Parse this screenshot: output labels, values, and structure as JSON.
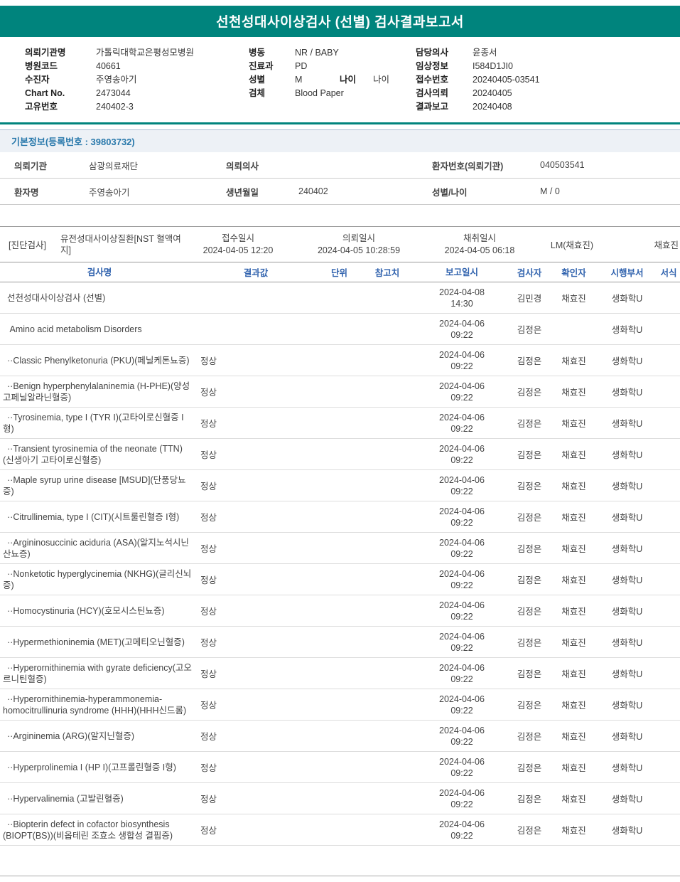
{
  "title": "선천성대사이상검사 (선별) 검사결과보고서",
  "accent_color": "#00847D",
  "header": {
    "left": [
      {
        "label": "의뢰기관명",
        "value": "가톨릭대학교은평성모병원"
      },
      {
        "label": "병원코드",
        "value": "40661"
      },
      {
        "label": "수진자",
        "value": "주영송아기"
      },
      {
        "label": "Chart No.",
        "value": "2473044"
      },
      {
        "label": "고유번호",
        "value": "240402-3"
      }
    ],
    "middle": [
      {
        "label": "병동",
        "value": "NR / BABY"
      },
      {
        "label": "진료과",
        "value": "PD"
      },
      {
        "label": "성별",
        "value": "M",
        "label2": "나이",
        "value2": "나이"
      },
      {
        "label": "검체",
        "value": "Blood Paper"
      }
    ],
    "right": [
      {
        "label": "담당의사",
        "value": "윤종서"
      },
      {
        "label": "임상정보",
        "value": "I584D1JI0"
      },
      {
        "label": "접수번호",
        "value": "20240405-03541"
      },
      {
        "label": "검사의뢰",
        "value": "20240405"
      },
      {
        "label": "결과보고",
        "value": "20240408"
      }
    ]
  },
  "basic_info": {
    "heading": "기본정보(등록번호 : 39803732)",
    "rows": [
      [
        {
          "label": "의뢰기관",
          "value": "삼광의료재단"
        },
        {
          "label": "의뢰의사",
          "value": ""
        },
        {
          "label": "환자번호(의뢰기관)",
          "value": "040503541"
        }
      ],
      [
        {
          "label": "환자명",
          "value": "주영송아기"
        },
        {
          "label": "생년월일",
          "value": "240402"
        },
        {
          "label": "성별/나이",
          "value": "M / 0"
        }
      ]
    ]
  },
  "exam_section": {
    "tag": "[진단검사]",
    "name": "유전성대사이상질환[NST 혈액여지]",
    "columns": [
      {
        "label": "접수일시",
        "value": "2024-04-05 12:20"
      },
      {
        "label": "의뢰일시",
        "value": "2024-04-05 10:28:59"
      },
      {
        "label": "채취일시",
        "value": "2024-04-05 06:18"
      }
    ],
    "collector": "LM(채효진)",
    "collector_right": "채효진"
  },
  "results_table": {
    "headers": [
      "검사명",
      "결과값",
      "단위",
      "참고치",
      "보고일시",
      "검사자",
      "확인자",
      "시행부서",
      "서식"
    ],
    "rows": [
      {
        "name": "선천성대사이상검사 (선별)",
        "result": "",
        "reported": "2024-04-08 14:30",
        "tester": "김민경",
        "verifier": "채효진",
        "dept": "생화학U"
      },
      {
        "name": " Amino acid metabolism Disorders",
        "result": "",
        "reported": "2024-04-06 09:22",
        "tester": "김정은",
        "verifier": "",
        "dept": "생화학U"
      },
      {
        "name": "··Classic Phenylketonuria (PKU)(페닐케톤뇨증)",
        "result": "정상",
        "reported": "2024-04-06 09:22",
        "tester": "김정은",
        "verifier": "채효진",
        "dept": "생화학U"
      },
      {
        "name": "··Benign hyperphenylalaninemia (H-PHE)(양성 고페닐알라닌혈증)",
        "result": "정상",
        "reported": "2024-04-06 09:22",
        "tester": "김정은",
        "verifier": "채효진",
        "dept": "생화학U"
      },
      {
        "name": "··Tyrosinemia, type I (TYR I)(고타이로신혈증 I형)",
        "result": "정상",
        "reported": "2024-04-06 09:22",
        "tester": "김정은",
        "verifier": "채효진",
        "dept": "생화학U"
      },
      {
        "name": "··Transient tyrosinemia of the neonate (TTN)(신생아기 고타이로신혈증)",
        "result": "정상",
        "reported": "2024-04-06 09:22",
        "tester": "김정은",
        "verifier": "채효진",
        "dept": "생화학U"
      },
      {
        "name": "··Maple syrup urine disease [MSUD](단풍당뇨증)",
        "result": "정상",
        "reported": "2024-04-06 09:22",
        "tester": "김정은",
        "verifier": "채효진",
        "dept": "생화학U"
      },
      {
        "name": "··Citrullinemia, type I (CIT)(시트룰린혈증 I형)",
        "result": "정상",
        "reported": "2024-04-06 09:22",
        "tester": "김정은",
        "verifier": "채효진",
        "dept": "생화학U"
      },
      {
        "name": "··Argininosuccinic aciduria (ASA)(알지노석시닌산뇨증)",
        "result": "정상",
        "reported": "2024-04-06 09:22",
        "tester": "김정은",
        "verifier": "채효진",
        "dept": "생화학U"
      },
      {
        "name": "··Nonketotic hyperglycinemia (NKHG)(글리신뇌증)",
        "result": "정상",
        "reported": "2024-04-06 09:22",
        "tester": "김정은",
        "verifier": "채효진",
        "dept": "생화학U"
      },
      {
        "name": "··Homocystinuria (HCY)(호모시스틴뇨증)",
        "result": "정상",
        "reported": "2024-04-06 09:22",
        "tester": "김정은",
        "verifier": "채효진",
        "dept": "생화학U"
      },
      {
        "name": "··Hypermethioninemia (MET)(고메티오닌혈증)",
        "result": "정상",
        "reported": "2024-04-06 09:22",
        "tester": "김정은",
        "verifier": "채효진",
        "dept": "생화학U"
      },
      {
        "name": "··Hyperornithinemia with gyrate deficiency(고오르니틴혈증)",
        "result": "정상",
        "reported": "2024-04-06 09:22",
        "tester": "김정은",
        "verifier": "채효진",
        "dept": "생화학U"
      },
      {
        "name": "··Hyperornithinemia-hyperammonemia-homocitrullinuria syndrome (HHH)(HHH신드롬)",
        "result": "정상",
        "reported": "2024-04-06 09:22",
        "tester": "김정은",
        "verifier": "채효진",
        "dept": "생화학U"
      },
      {
        "name": "··Argininemia (ARG)(알지닌혈증)",
        "result": "정상",
        "reported": "2024-04-06 09:22",
        "tester": "김정은",
        "verifier": "채효진",
        "dept": "생화학U"
      },
      {
        "name": "··Hyperprolinemia I (HP I)(고프롤린혈증 I형)",
        "result": "정상",
        "reported": "2024-04-06 09:22",
        "tester": "김정은",
        "verifier": "채효진",
        "dept": "생화학U"
      },
      {
        "name": "··Hypervalinemia (고발린혈증)",
        "result": "정상",
        "reported": "2024-04-06 09:22",
        "tester": "김정은",
        "verifier": "채효진",
        "dept": "생화학U"
      },
      {
        "name": "··Biopterin defect in cofactor biosynthesis (BIOPT(BS))(비옵테린 조효소 생합성 결핍증)",
        "result": "정상",
        "reported": "2024-04-06 09:22",
        "tester": "김정은",
        "verifier": "채효진",
        "dept": "생화학U"
      }
    ]
  }
}
